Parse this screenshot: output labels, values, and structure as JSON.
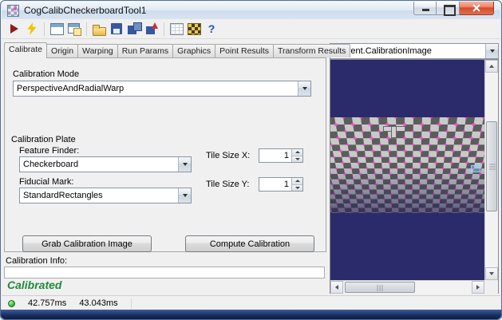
{
  "colors": {
    "accent-green": "#1f8a3a",
    "status-green": "#3cb83c",
    "image-bg": "#2b2b6b",
    "marker-magenta": "#f050d0"
  },
  "window": {
    "title": "CogCalibCheckerboardTool1"
  },
  "toolbar": {
    "help_glyph": "?",
    "icons": [
      "run-icon",
      "electric-run-icon",
      "image-display-icon",
      "float-display-icon",
      "open-icon",
      "save-icon",
      "save-subtools-icon",
      "import-icon",
      "results-icon",
      "calibration-icon",
      "help-icon"
    ]
  },
  "tabs": [
    {
      "label": "Calibrate"
    },
    {
      "label": "Origin"
    },
    {
      "label": "Warping"
    },
    {
      "label": "Run Params"
    },
    {
      "label": "Graphics"
    },
    {
      "label": "Point Results"
    },
    {
      "label": "Transform Results"
    }
  ],
  "calibration_mode": {
    "group_label": "Calibration Mode",
    "value": "PerspectiveAndRadialWarp"
  },
  "calibration_plate": {
    "group_label": "Calibration Plate",
    "feature_finder_label": "Feature Finder:",
    "feature_finder_value": "Checkerboard",
    "fiducial_mark_label": "Fiducial Mark:",
    "fiducial_mark_value": "StandardRectangles",
    "tile_size_x_label": "Tile Size X:",
    "tile_size_x_value": "1",
    "tile_size_y_label": "Tile Size Y:",
    "tile_size_y_value": "1"
  },
  "actions": {
    "grab_button": "Grab Calibration Image",
    "compute_button": "Compute Calibration"
  },
  "calibration_info": {
    "label": "Calibration Info:",
    "value": "",
    "status": "Calibrated"
  },
  "image_panel": {
    "selected_view": "Current.CalibrationImage"
  },
  "status_bar": {
    "run_time": "42.757ms",
    "total_time": "43.043ms"
  }
}
